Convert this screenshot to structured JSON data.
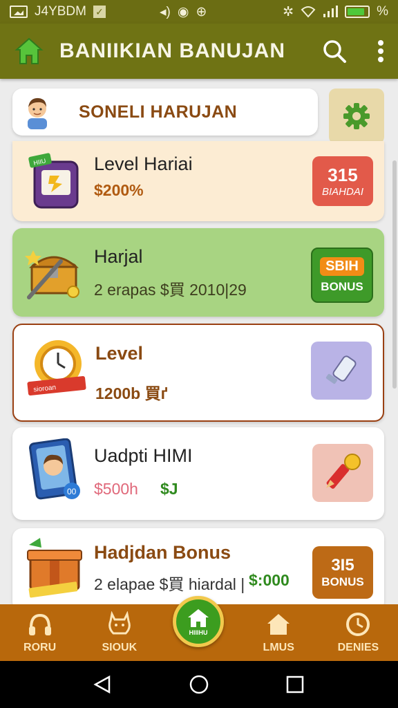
{
  "status_bar": {
    "carrier": "J4YBDM",
    "battery_label": "%",
    "battery_level": 0.85
  },
  "app_bar": {
    "title": "BANIIKIAN BANUJAN"
  },
  "profile": {
    "name": "SONELI HARUJAN"
  },
  "cards": [
    {
      "title": "Level Hariai",
      "subtitle": "$200%",
      "badge_top": "315",
      "badge_bottom": "BIAHDAI",
      "badge_color": "#e25a4a"
    },
    {
      "title": "Harjal",
      "subtitle": "2 erapas $買 2010|29",
      "badge_top": "SΒΙН",
      "badge_bottom": "BONUS",
      "badge_color": "#3e9a29"
    },
    {
      "title": "Level",
      "subtitle": "1200b 買ґ",
      "badge_top": "",
      "badge_bottom": "",
      "badge_color": "#b9b3e6"
    },
    {
      "title": "Uadpti HIMI",
      "subtitle_left": "$500h",
      "subtitle_right": "$J",
      "badge_color": "#f0c2b6"
    },
    {
      "title": "Hadjdan Bonus",
      "subtitle_left": "2 elapae $買 hiardal |",
      "subtitle_right": "$:000",
      "badge_top": "3I5",
      "badge_bottom": "BONUS",
      "badge_color": "#bd6a16"
    }
  ],
  "bottom_nav": [
    {
      "label": "RORU",
      "icon": "headphones-icon"
    },
    {
      "label": "SIOUK",
      "icon": "creature-icon"
    },
    {
      "label": "HIIIHU",
      "icon": "home-icon"
    },
    {
      "label": "LMUS",
      "icon": "house-icon"
    },
    {
      "label": "DENIES",
      "icon": "clock-icon"
    }
  ],
  "colors": {
    "appbar": "#6f7314",
    "accent_brown": "#8a4a12",
    "nav": "#b8680c",
    "green": "#3e9a29"
  }
}
